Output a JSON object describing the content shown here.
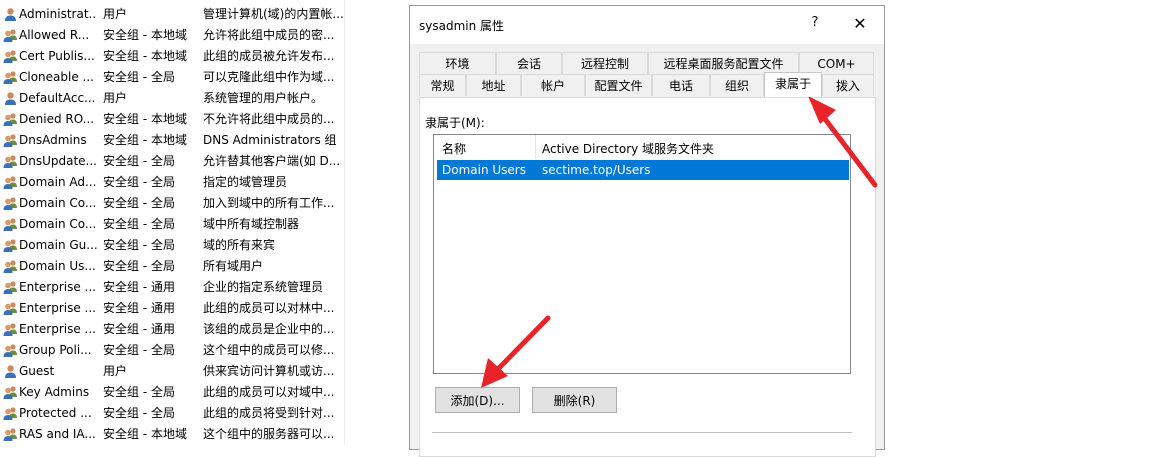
{
  "list": [
    {
      "name": "Administrat...",
      "type": "用户",
      "desc": "管理计算机(域)的内置帐...",
      "icon": "user-icon"
    },
    {
      "name": "Allowed R...",
      "type": "安全组 - 本地域",
      "desc": "允许将此组中成员的密...",
      "icon": "group-icon"
    },
    {
      "name": "Cert Publis...",
      "type": "安全组 - 本地域",
      "desc": "此组的成员被允许发布...",
      "icon": "group-icon"
    },
    {
      "name": "Cloneable ...",
      "type": "安全组 - 全局",
      "desc": "可以克隆此组中作为域...",
      "icon": "group-icon"
    },
    {
      "name": "DefaultAcc...",
      "type": "用户",
      "desc": "系统管理的用户帐户。",
      "icon": "user-icon"
    },
    {
      "name": "Denied RO...",
      "type": "安全组 - 本地域",
      "desc": "不允许将此组中成员的...",
      "icon": "group-icon"
    },
    {
      "name": "DnsAdmins",
      "type": "安全组 - 本地域",
      "desc": "DNS Administrators 组",
      "icon": "group-icon"
    },
    {
      "name": "DnsUpdate...",
      "type": "安全组 - 全局",
      "desc": "允许替其他客户端(如 D...",
      "icon": "group-icon"
    },
    {
      "name": "Domain Ad...",
      "type": "安全组 - 全局",
      "desc": "指定的域管理员",
      "icon": "group-icon"
    },
    {
      "name": "Domain Co...",
      "type": "安全组 - 全局",
      "desc": "加入到域中的所有工作...",
      "icon": "group-icon"
    },
    {
      "name": "Domain Co...",
      "type": "安全组 - 全局",
      "desc": "域中所有域控制器",
      "icon": "group-icon"
    },
    {
      "name": "Domain Gu...",
      "type": "安全组 - 全局",
      "desc": "域的所有来宾",
      "icon": "group-icon"
    },
    {
      "name": "Domain Us...",
      "type": "安全组 - 全局",
      "desc": "所有域用户",
      "icon": "group-icon"
    },
    {
      "name": "Enterprise ...",
      "type": "安全组 - 通用",
      "desc": "企业的指定系统管理员",
      "icon": "group-icon"
    },
    {
      "name": "Enterprise ...",
      "type": "安全组 - 通用",
      "desc": "此组的成员可以对林中...",
      "icon": "group-icon"
    },
    {
      "name": "Enterprise ...",
      "type": "安全组 - 通用",
      "desc": "该组的成员是企业中的...",
      "icon": "group-icon"
    },
    {
      "name": "Group Poli...",
      "type": "安全组 - 全局",
      "desc": "这个组中的成员可以修...",
      "icon": "group-icon"
    },
    {
      "name": "Guest",
      "type": "用户",
      "desc": "供来宾访问计算机或访...",
      "icon": "user-icon"
    },
    {
      "name": "Key Admins",
      "type": "安全组 - 全局",
      "desc": "此组的成员可以对域中...",
      "icon": "group-icon"
    },
    {
      "name": "Protected ...",
      "type": "安全组 - 全局",
      "desc": "此组的成员将受到针对...",
      "icon": "group-icon"
    },
    {
      "name": "RAS and IA...",
      "type": "安全组 - 本地域",
      "desc": "这个组中的服务器可以...",
      "icon": "group-icon"
    }
  ],
  "dialog": {
    "title": "sysadmin 属性",
    "help": "?",
    "close": "✕",
    "tabs_row1": [
      "环境",
      "会话",
      "远程控制",
      "远程桌面服务配置文件",
      "COM+"
    ],
    "tabs_row2": [
      "常规",
      "地址",
      "帐户",
      "配置文件",
      "电话",
      "组织",
      "隶属于",
      "拨入"
    ],
    "active_tab": "隶属于",
    "section_label": "隶属于(M):",
    "columns": [
      "名称",
      "Active Directory 域服务文件夹"
    ],
    "rows": [
      {
        "name": "Domain Users",
        "folder": "sectime.top/Users"
      }
    ],
    "add_button": "添加(D)...",
    "remove_button": "删除(R)"
  },
  "colors": {
    "selection": "#0078d7",
    "arrow": "#e8232a"
  }
}
